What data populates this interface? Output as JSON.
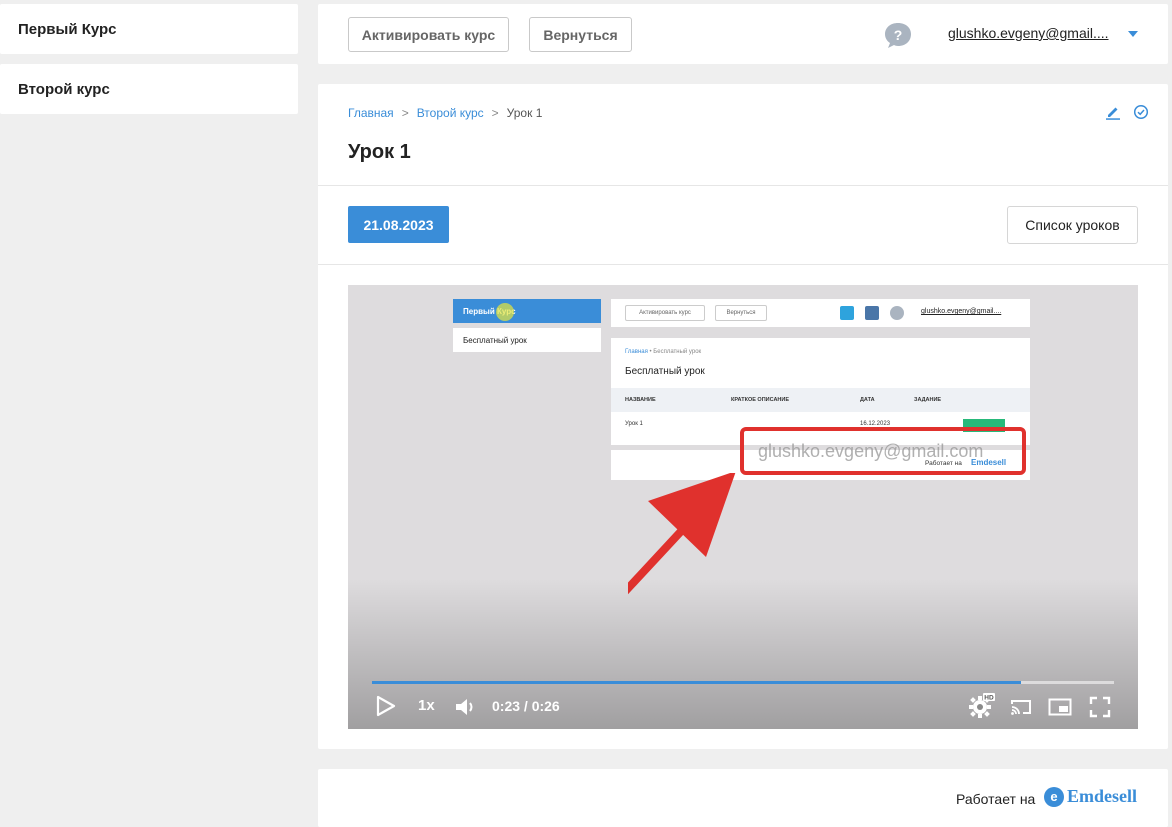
{
  "sidebar": {
    "items": [
      {
        "label": "Первый Курс"
      },
      {
        "label": "Второй курс"
      }
    ]
  },
  "topbar": {
    "activate_label": "Активировать курс",
    "back_label": "Вернуться",
    "help_icon": "question-bubble-icon",
    "user_email": "glushko.evgeny@gmail...."
  },
  "breadcrumb": {
    "home": "Главная",
    "course": "Второй курс",
    "current": "Урок 1",
    "separator": ">"
  },
  "lesson": {
    "title": "Урок 1",
    "date": "21.08.2023",
    "list_button": "Список уроков"
  },
  "video": {
    "progress": 0.875,
    "speed": "1x",
    "time": "0:23 / 0:26",
    "hd_badge": "HD",
    "inner": {
      "sidebar_active": "Первый Курс",
      "sidebar_item": "Бесплатный урок",
      "activate": "Активировать курс",
      "back": "Вернуться",
      "email": "glushko.evgeny@gmail....",
      "bc_home": "Главная",
      "bc_sep": "•",
      "bc_current": "Бесплатный урок",
      "title": "Бесплатный урок",
      "col_name": "НАЗВАНИЕ",
      "col_desc": "КРАТКОЕ ОПИСАНИЕ",
      "col_date": "ДАТА",
      "col_task": "ЗАДАНИЕ",
      "row_name": "Урок 1",
      "row_date": "16.12.2023",
      "works_on": "Работает на",
      "logo": "Emdesell",
      "watermark": "glushko.evgeny@gmail.com"
    }
  },
  "footer": {
    "works_on": "Работает на",
    "logo_text": "Emdesell",
    "logo_letter": "e"
  },
  "colors": {
    "accent": "#3a8dd8",
    "background": "#efefef",
    "annotation_red": "#e0312d"
  }
}
